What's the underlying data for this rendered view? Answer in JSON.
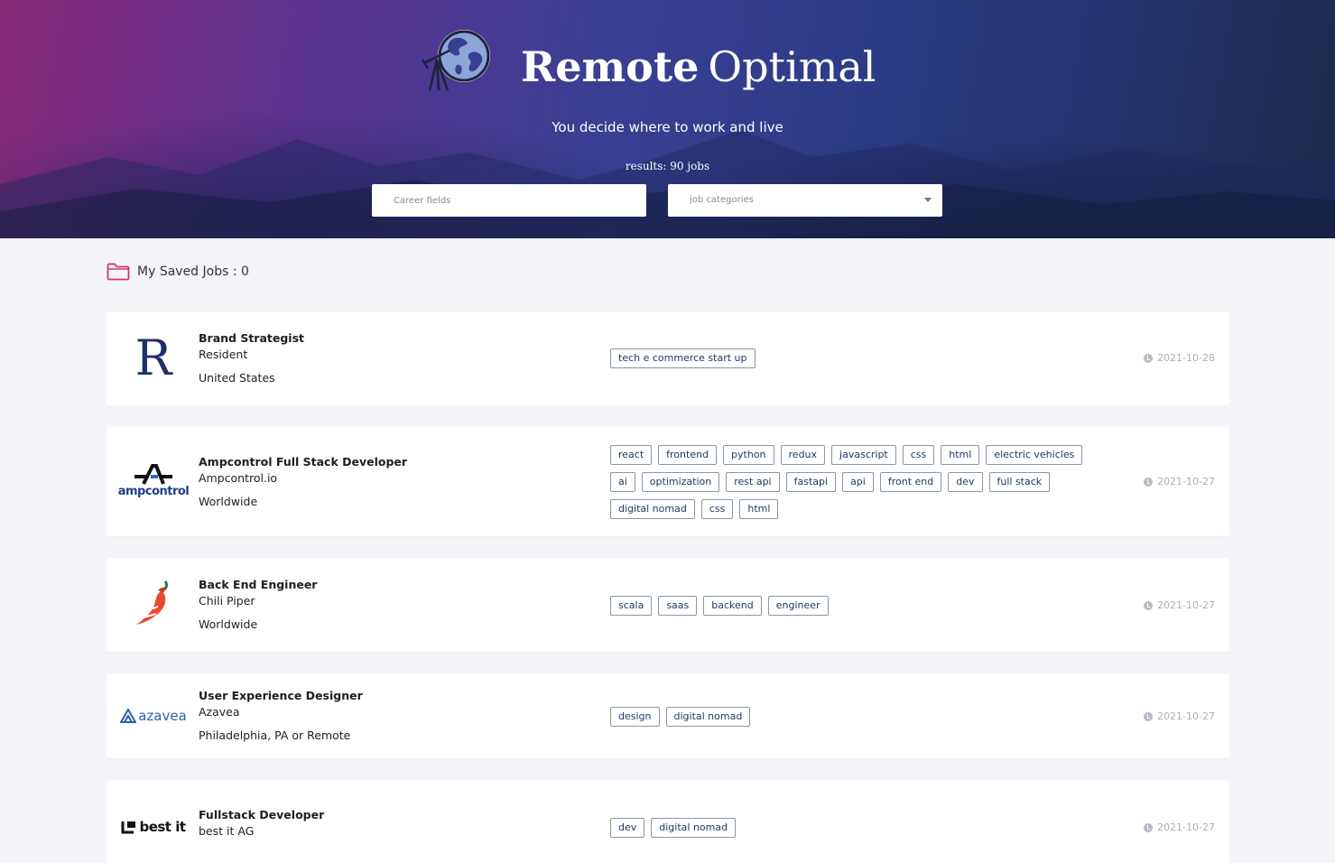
{
  "header": {
    "brand_bold": "Remote",
    "brand_light": "Optimal",
    "tagline": "You decide where to work and live",
    "results": "results: 90 jobs",
    "search_placeholder": "Career fields",
    "category_placeholder": "job categories"
  },
  "saved": {
    "label": "My Saved Jobs : 0",
    "icon": "folder-icon",
    "color": "#d6337a"
  },
  "jobs": [
    {
      "title": "Brand Strategist",
      "company": "Resident",
      "location": "United States",
      "logo": "resident-logo",
      "logo_text": "R",
      "tags": [
        "tech e commerce start up"
      ],
      "date": "2021-10-28"
    },
    {
      "title": "Ampcontrol Full Stack Developer",
      "company": "Ampcontrol.io",
      "location": "Worldwide",
      "logo": "ampcontrol-logo",
      "logo_text": "ampcontrol",
      "tags": [
        "react",
        "frontend",
        "python",
        "redux",
        "javascript",
        "css",
        "html",
        "electric vehicles",
        "ai",
        "optimization",
        "rest api",
        "fastapi",
        "api",
        "front end",
        "dev",
        "full stack",
        "digital nomad",
        "css",
        "html"
      ],
      "date": "2021-10-27"
    },
    {
      "title": "Back End Engineer",
      "company": "Chili Piper",
      "location": "Worldwide",
      "logo": "chili-piper-logo",
      "tags": [
        "scala",
        "saas",
        "backend",
        "engineer"
      ],
      "date": "2021-10-27"
    },
    {
      "title": "User Experience Designer",
      "company": "Azavea",
      "location": "Philadelphia, PA or Remote",
      "logo": "azavea-logo",
      "logo_text": "azavea",
      "tags": [
        "design",
        "digital nomad"
      ],
      "date": "2021-10-27"
    },
    {
      "title": "Fullstack Developer",
      "company": "best it AG",
      "location": "",
      "logo": "best-it-logo",
      "logo_text": "best it",
      "tags": [
        "dev",
        "digital nomad"
      ],
      "date": "2021-10-27"
    }
  ]
}
